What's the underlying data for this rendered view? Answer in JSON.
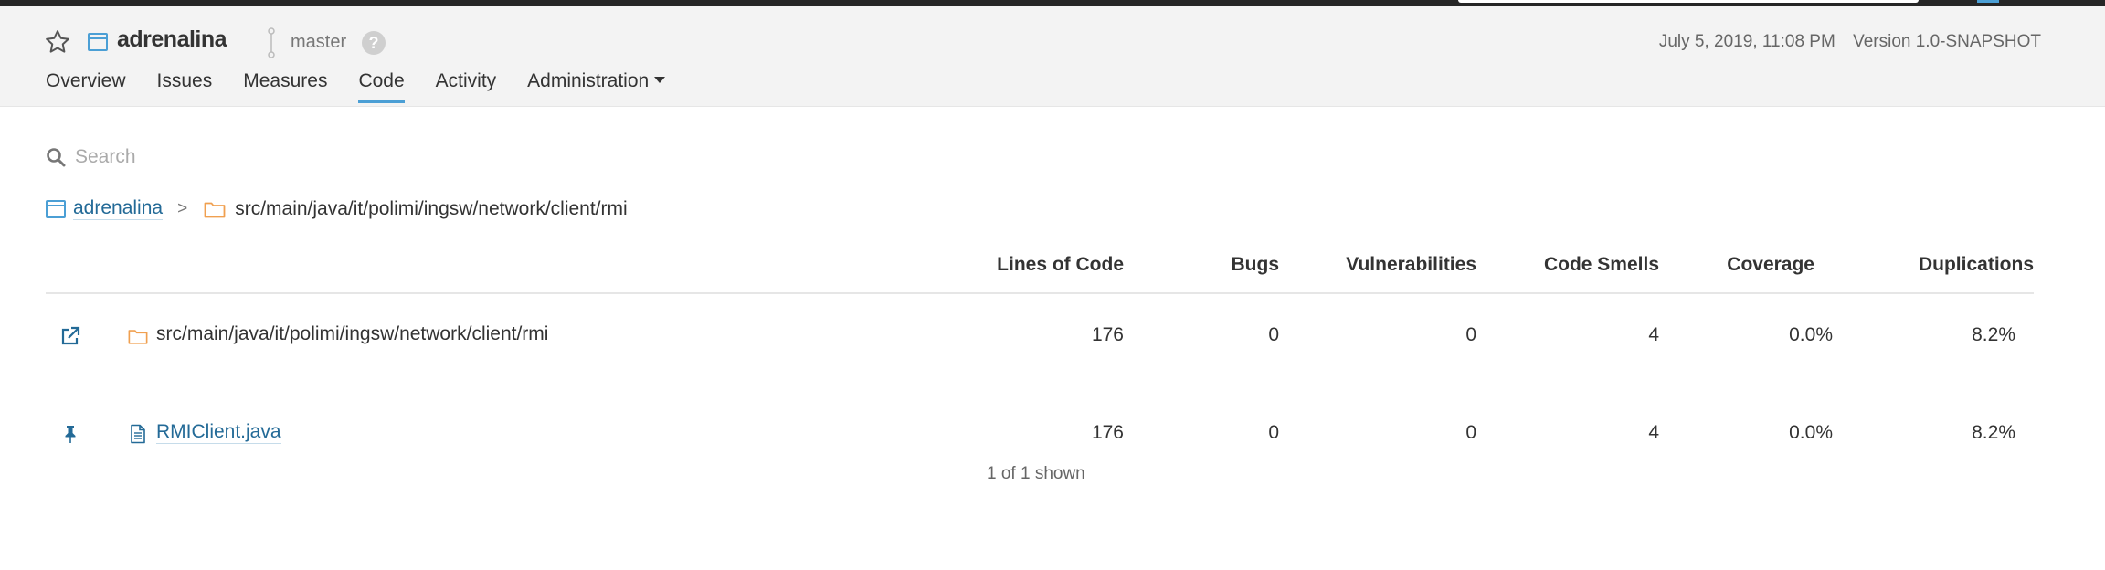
{
  "header": {
    "project_name": "adrenalina",
    "branch": "master",
    "help": "?",
    "date": "July 5, 2019, 11:08 PM",
    "version": "Version 1.0-SNAPSHOT"
  },
  "nav": {
    "overview": "Overview",
    "issues": "Issues",
    "measures": "Measures",
    "code": "Code",
    "activity": "Activity",
    "administration": "Administration",
    "active_tab": "Code"
  },
  "search": {
    "placeholder": "Search",
    "value": ""
  },
  "breadcrumb": {
    "project": "adrenalina",
    "separator": ">",
    "current": "src/main/java/it/polimi/ingsw/network/client/rmi"
  },
  "table": {
    "columns": [
      "Lines of Code",
      "Bugs",
      "Vulnerabilities",
      "Code Smells",
      "Coverage",
      "Duplications"
    ],
    "rows": [
      {
        "icon": "external-link-icon",
        "type_icon": "folder-icon",
        "name": "src/main/java/it/polimi/ingsw/network/client/rmi",
        "lines": "176",
        "bugs": "0",
        "vulnerabilities": "0",
        "code_smells": "4",
        "coverage": "0.0%",
        "duplications": "8.2%"
      },
      {
        "icon": "pin-icon",
        "type_icon": "file-icon",
        "name": "RMIClient.java",
        "lines": "176",
        "bugs": "0",
        "vulnerabilities": "0",
        "code_smells": "4",
        "coverage": "0.0%",
        "duplications": "8.2%"
      }
    ],
    "shown": "1 of 1 shown"
  },
  "colors": {
    "accent": "#4b9fd5",
    "link": "#236a97",
    "folder": "#f0a050",
    "header_bg": "#f3f3f3",
    "topbar": "#262626"
  }
}
